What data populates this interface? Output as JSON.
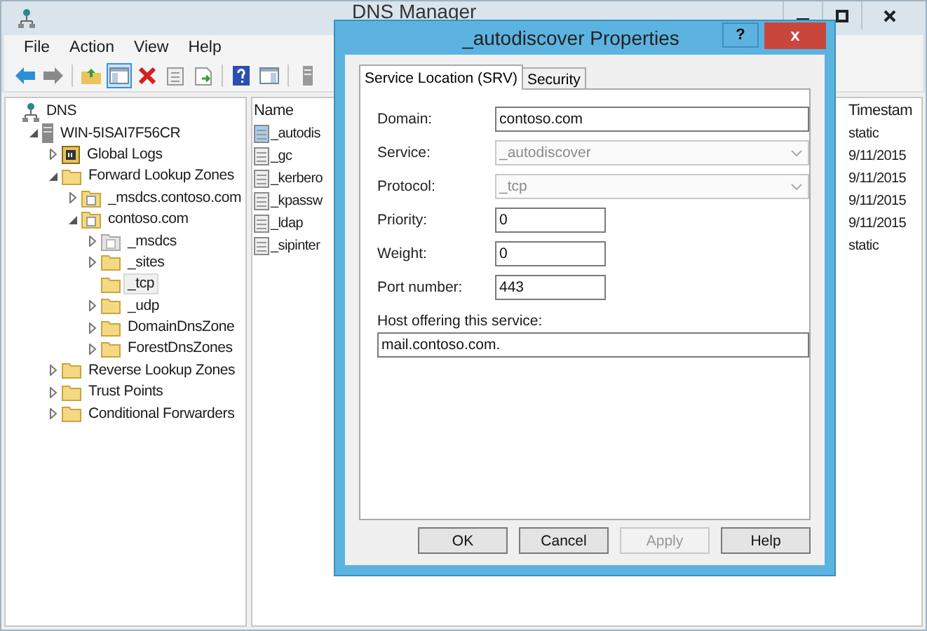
{
  "window": {
    "title": "DNS Manager"
  },
  "menu": [
    "File",
    "Action",
    "View",
    "Help"
  ],
  "toolbar": [
    {
      "buttons": [
        {
          "kind": "back",
          "pressed": false
        },
        {
          "kind": "forward",
          "pressed": false
        }
      ]
    },
    {
      "buttons": [
        {
          "kind": "up",
          "pressed": false
        },
        {
          "kind": "pane",
          "pressed": true
        },
        {
          "kind": "delete",
          "pressed": false
        },
        {
          "kind": "props",
          "pressed": false
        },
        {
          "kind": "export",
          "pressed": false
        }
      ]
    },
    {
      "buttons": [
        {
          "kind": "help",
          "pressed": false
        },
        {
          "kind": "pane2",
          "pressed": false
        }
      ]
    },
    {
      "buttons": [
        {
          "kind": "server",
          "pressed": false
        }
      ]
    }
  ],
  "tree": [
    {
      "label": "DNS",
      "kind": "dns",
      "expandable": false,
      "selected": false,
      "children": [
        {
          "label": "WIN-5ISAI7F56CR",
          "kind": "server",
          "expandable": true,
          "expanded": true,
          "selected": false,
          "children": [
            {
              "label": "Global Logs",
              "kind": "logs",
              "expandable": true,
              "expanded": false,
              "selected": false
            },
            {
              "label": "Forward Lookup Zones",
              "kind": "folder",
              "expandable": true,
              "expanded": true,
              "selected": false,
              "children": [
                {
                  "label": "_msdcs.contoso.com",
                  "kind": "zone",
                  "expandable": true,
                  "expanded": false,
                  "selected": false
                },
                {
                  "label": "contoso.com",
                  "kind": "zone",
                  "expandable": true,
                  "expanded": true,
                  "selected": false,
                  "children": [
                    {
                      "label": "_msdcs",
                      "kind": "zone-gray",
                      "expandable": true,
                      "expanded": false,
                      "selected": false
                    },
                    {
                      "label": "_sites",
                      "kind": "folder",
                      "expandable": true,
                      "expanded": false,
                      "selected": false
                    },
                    {
                      "label": "_tcp",
                      "kind": "folder",
                      "expandable": false,
                      "selected": true
                    },
                    {
                      "label": "_udp",
                      "kind": "folder",
                      "expandable": true,
                      "expanded": false,
                      "selected": false
                    },
                    {
                      "label": "DomainDnsZone",
                      "kind": "folder",
                      "expandable": true,
                      "expanded": false,
                      "selected": false
                    },
                    {
                      "label": "ForestDnsZones",
                      "kind": "folder",
                      "expandable": true,
                      "expanded": false,
                      "selected": false
                    }
                  ]
                }
              ]
            },
            {
              "label": "Reverse Lookup Zones",
              "kind": "folder",
              "expandable": true,
              "expanded": false,
              "selected": false
            },
            {
              "label": "Trust Points",
              "kind": "folder",
              "expandable": true,
              "expanded": false,
              "selected": false
            },
            {
              "label": "Conditional Forwarders",
              "kind": "folder",
              "expandable": true,
              "expanded": false,
              "selected": false
            }
          ]
        }
      ]
    }
  ],
  "list": {
    "columns": [
      "Name",
      "Timestam"
    ],
    "rows": [
      {
        "name": "_autodis",
        "timestamp": "static",
        "selected": true
      },
      {
        "name": "_gc",
        "timestamp": "9/11/2015",
        "selected": false
      },
      {
        "name": "_kerbero",
        "timestamp": "9/11/2015",
        "selected": false
      },
      {
        "name": "_kpassw",
        "timestamp": "9/11/2015",
        "selected": false
      },
      {
        "name": "_ldap",
        "timestamp": "9/11/2015",
        "selected": false
      },
      {
        "name": "_sipinter",
        "timestamp": "static",
        "selected": false
      }
    ]
  },
  "dialog": {
    "title": "_autodiscover Properties",
    "help": "?",
    "close": "x",
    "tabs": [
      {
        "label": "Service Location (SRV)",
        "selected": true
      },
      {
        "label": "Security",
        "selected": false
      }
    ],
    "fields": [
      {
        "label": "Domain:",
        "value": "contoso.com",
        "kind": "text",
        "disabled": false
      },
      {
        "label": "Service:",
        "value": "_autodiscover",
        "kind": "combo",
        "disabled": true
      },
      {
        "label": "Protocol:",
        "value": "_tcp",
        "kind": "combo",
        "disabled": true
      },
      {
        "label": "Priority:",
        "value": "0",
        "kind": "short",
        "disabled": false
      },
      {
        "label": "Weight:",
        "value": "0",
        "kind": "short",
        "disabled": false
      },
      {
        "label": "Port number:",
        "value": "443",
        "kind": "short",
        "disabled": false
      }
    ],
    "host": {
      "label": "Host offering this service:",
      "value": "mail.contoso.com."
    },
    "buttons": [
      {
        "label": "OK",
        "disabled": false
      },
      {
        "label": "Cancel",
        "disabled": false
      },
      {
        "label": "Apply",
        "disabled": true
      },
      {
        "label": "Help",
        "disabled": false
      }
    ]
  }
}
